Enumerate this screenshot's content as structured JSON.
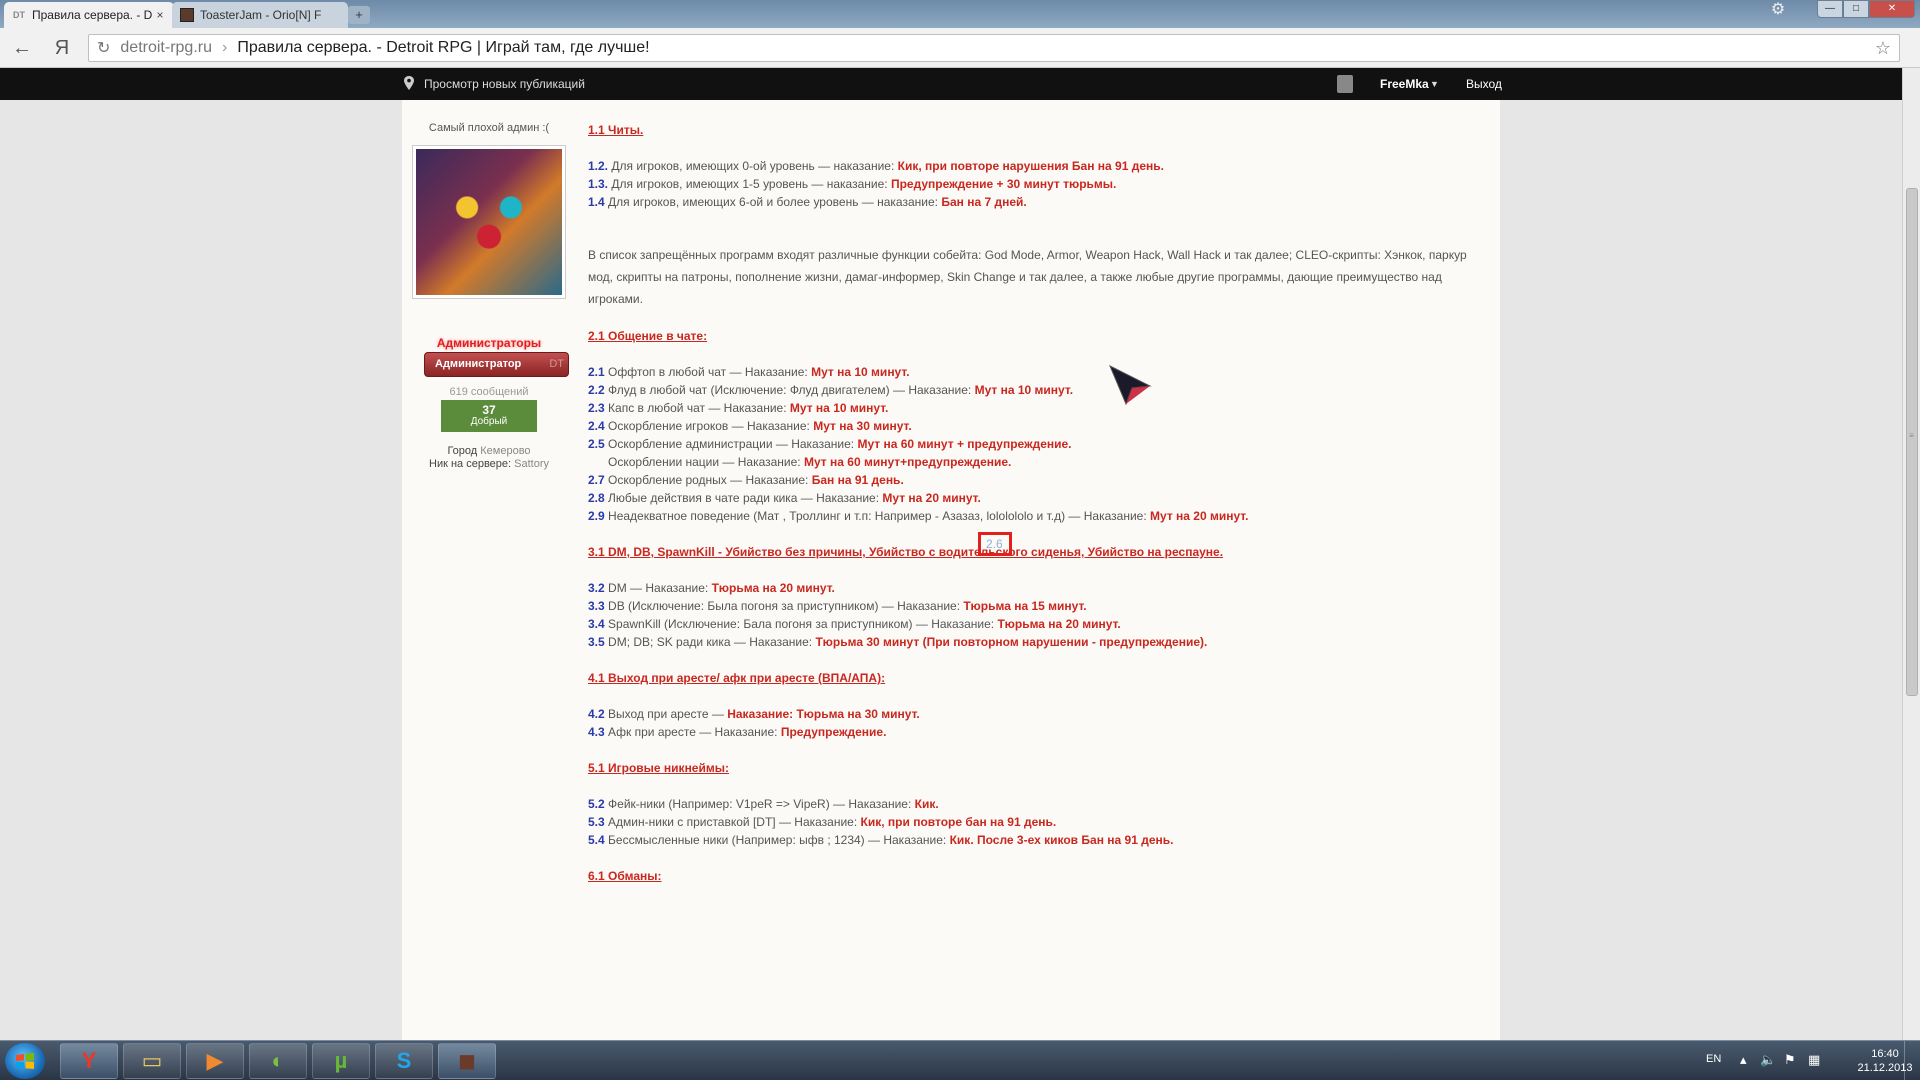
{
  "browser": {
    "tabs": [
      {
        "title": "Правила сервера. - D",
        "favicon": "DT"
      },
      {
        "title": "ToasterJam - Orio[N] F",
        "favicon": ""
      }
    ],
    "new_tab_glyph": "+",
    "close_glyph": "×",
    "domain": "detroit-rpg.ru",
    "separator": "›",
    "page_title": "Правила сервера. - Detroit RPG | Играй там, где лучше!",
    "window_controls": {
      "minimize": "—",
      "maximize": "□",
      "close": "✕"
    },
    "back_glyph": "←",
    "yandex_glyph": "Я"
  },
  "topnav": {
    "new_posts": "Просмотр новых публикаций",
    "username": "FreeMka",
    "logout": "Выход"
  },
  "profile": {
    "rank_title": "Самый плохой админ :(",
    "avatar_caption": "",
    "group_name": "Администраторы",
    "badge_label": "Администратор",
    "badge_suffix": "DT",
    "post_count": "619 сообщений",
    "reputation_value": "37",
    "reputation_label": "Добрый",
    "city_label": "Город",
    "city_value": "Кемерово",
    "nick_label": "Ник на сервере:",
    "nick_value": "Sattory"
  },
  "rules": [
    {
      "type": "heading",
      "text": "1.1 Читы."
    },
    {
      "type": "rule",
      "num": "1.2.",
      "text": "Для игроков, имеющих 0-ой уровень — наказание:",
      "penalty": "Кик, при повторе нарушения Бан на 91 день."
    },
    {
      "type": "rule",
      "num": "1.3.",
      "text": "Для игроков, имеющих 1-5 уровень — наказание:",
      "penalty": "Предупреждение + 30 минут тюрьмы."
    },
    {
      "type": "rule",
      "num": "1.4",
      "text": "Для игроков, имеющих 6-ой и более уровень — наказание:",
      "penalty": "Бан на 7 дней."
    },
    {
      "type": "paragraph",
      "text": "В список запрещённых программ входят различные функции собейта: God Mode, Armor, Weapon Hack, Wall Hack и так далее; CLEO-скрипты: Хэнкок, паркур мод, скрипты на патроны, пополнение жизни, дамаг-информер, Skin Change и так далее, а также любые другие программы, дающие преимущество над игроками."
    },
    {
      "type": "heading",
      "text": "2.1 Общение в чате:"
    },
    {
      "type": "rule",
      "num": "2.1",
      "text": "Оффтоп в любой чат — Наказание:",
      "penalty": "Мут на 10 минут."
    },
    {
      "type": "rule",
      "num": "2.2",
      "text": "Флуд в любой чат (Исключение: Флуд двигателем) — Наказание:",
      "penalty": "Мут на 10 минут."
    },
    {
      "type": "rule",
      "num": "2.3",
      "text": "Капс в любой чат — Наказание:",
      "penalty": "Мут на 10 минут."
    },
    {
      "type": "rule",
      "num": "2.4",
      "text": "Оскорбление игроков — Наказание:",
      "penalty": "Мут на 30 минут."
    },
    {
      "type": "rule",
      "num": "2.5",
      "text": "Оскорбление администрации — Наказание:",
      "penalty": "Мут на 60 минут + предупреждение."
    },
    {
      "type": "rule",
      "num": "2.6",
      "text": "Оскорблении нации — Наказание:",
      "penalty": "Мут на 60 минут+предупреждение."
    },
    {
      "type": "rule",
      "num": "2.7",
      "text": "Оскорбление родных — Наказание:",
      "penalty": "Бан на 91 день."
    },
    {
      "type": "rule",
      "num": "2.8",
      "text": "Любые действия в чате ради кика — Наказание:",
      "penalty": "Мут на 20 минут."
    },
    {
      "type": "rule",
      "num": "2.9",
      "text": "Неадекватное поведение (Мат , Троллинг и т.п: Например - Азазаз, lololololo и т.д) — Наказание:",
      "penalty": "Мут на 20 минут."
    },
    {
      "type": "heading",
      "text": "3.1 DM, DB, SpawnKill - Убийство без причины, Убийство с водительского сиденья, Убийство на респауне."
    },
    {
      "type": "rule",
      "num": "3.2",
      "text": "DM — Наказание:",
      "penalty": "Тюрьма на 20 минут."
    },
    {
      "type": "rule",
      "num": "3.3",
      "text": "DB (Исключение: Была погоня за приступником) — Наказание:",
      "penalty": "Тюрьма на 15 минут."
    },
    {
      "type": "rule",
      "num": "3.4",
      "text": "SpawnKill (Исключение: Бала погоня за приступником) — Наказание:",
      "penalty": "Тюрьма на 20 минут."
    },
    {
      "type": "rule",
      "num": "3.5",
      "text": "DM; DB; SK ради кика — Наказание:",
      "penalty": "Тюрьма 30 минут (При повторном нарушении - предупреждение)."
    },
    {
      "type": "heading",
      "text": "4.1 Выход при аресте/ афк при аресте (ВПА/АПА):"
    },
    {
      "type": "rule",
      "num": "4.2",
      "text": "Выход при аресте —",
      "penalty": "Наказание: Тюрьма на 30 минут."
    },
    {
      "type": "rule",
      "num": "4.3",
      "text": "Афк при аресте — Наказание:",
      "penalty": "Предупреждение."
    },
    {
      "type": "heading",
      "text": "5.1 Игровые никнеймы:"
    },
    {
      "type": "rule",
      "num": "5.2",
      "text": "Фейк-ники (Например: V1peR => VipeR) — Наказание:",
      "penalty": "Кик."
    },
    {
      "type": "rule",
      "num": "5.3",
      "text": "Админ-ники с приставкой [DT] — Наказание:",
      "penalty": "Кик, при повторе бан на 91 день."
    },
    {
      "type": "rule",
      "num": "5.4",
      "text": "Бессмысленные ники (Например: ыфв ; 1234) — Наказание:",
      "penalty": "Кик. После 3-ех киков Бан на 91 день."
    },
    {
      "type": "heading",
      "text": "6.1 Обманы:"
    }
  ],
  "highlighted_rule_num": "2.6",
  "taskbar": {
    "apps": [
      {
        "name": "yandex-browser",
        "glyph": "Y",
        "color": "#e8372c"
      },
      {
        "name": "file-explorer",
        "glyph": "▭",
        "color": "#e8c45a"
      },
      {
        "name": "media-player",
        "glyph": "▶",
        "color": "#f08a30"
      },
      {
        "name": "game-app",
        "glyph": "◐",
        "color": "#7ac043"
      },
      {
        "name": "utorrent",
        "glyph": "µ",
        "color": "#68b838"
      },
      {
        "name": "skype",
        "glyph": "S",
        "color": "#22a6e8"
      },
      {
        "name": "game-window",
        "glyph": "◼",
        "color": "#6a3a2a"
      }
    ],
    "language": "EN",
    "time": "16:40",
    "date": "21.12.2013"
  }
}
